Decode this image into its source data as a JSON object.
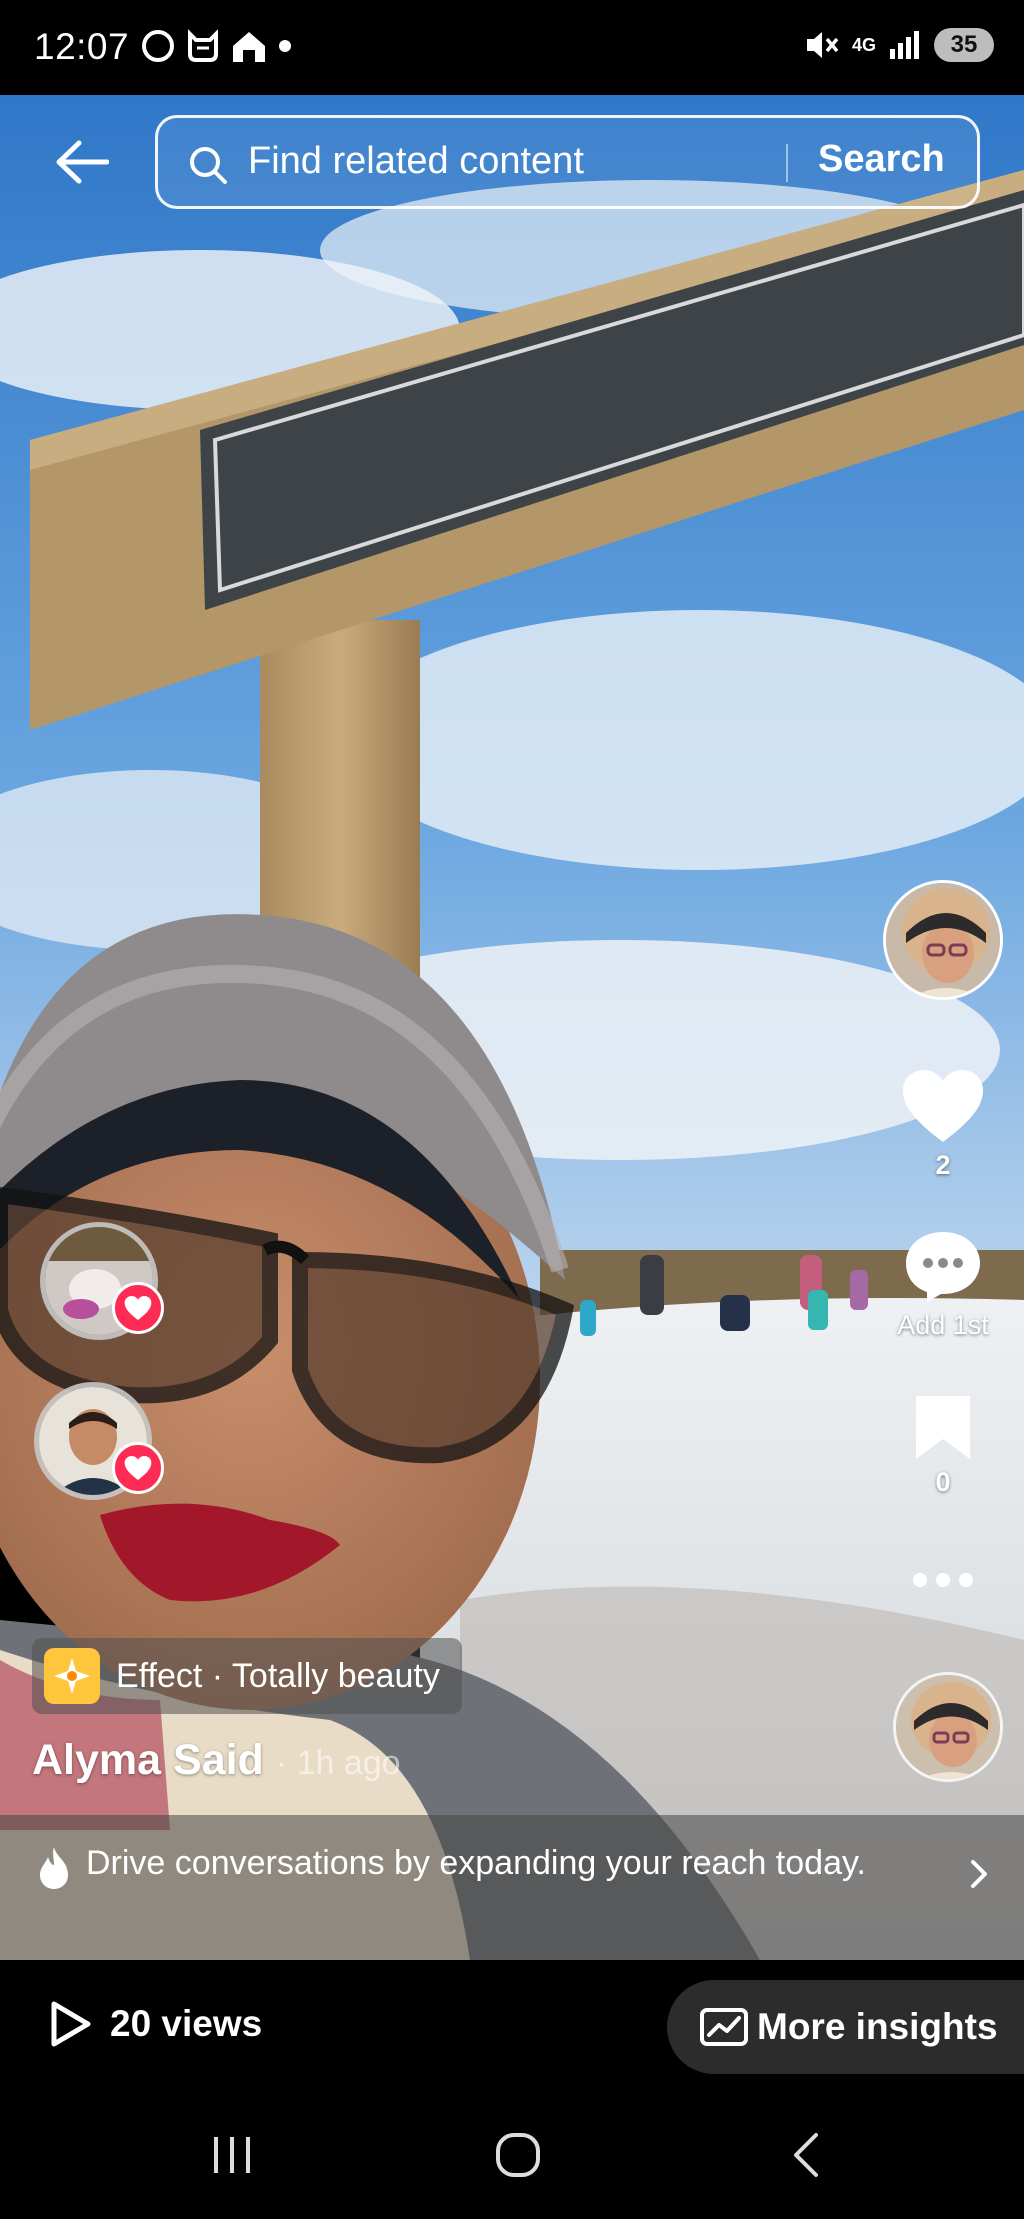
{
  "status_bar": {
    "time": "12:07",
    "network": "4G",
    "battery": "35",
    "icons": [
      "circle-status-icon",
      "cat-status-icon",
      "home-status-icon",
      "dot-status-icon",
      "mute-icon",
      "network-icon",
      "signal-icon",
      "battery-icon"
    ]
  },
  "search": {
    "placeholder": "Find related content",
    "button_label": "Search"
  },
  "rail": {
    "like_count": "2",
    "comment_label": "Add 1st",
    "bookmark_count": "0"
  },
  "caption": {
    "effect_label": "Effect · Totally beauty",
    "author": "Alyma Said",
    "time": "· 1h ago"
  },
  "promo": {
    "text": "Drive conversations by expanding your reach today."
  },
  "bottom": {
    "views_label": "20 views",
    "insights_label": "More insights"
  },
  "colors": {
    "like_red": "#fe2c55",
    "effect_yellow": "#ffc53d",
    "sky_blue": "#4a8fd6",
    "background": "#000000"
  }
}
